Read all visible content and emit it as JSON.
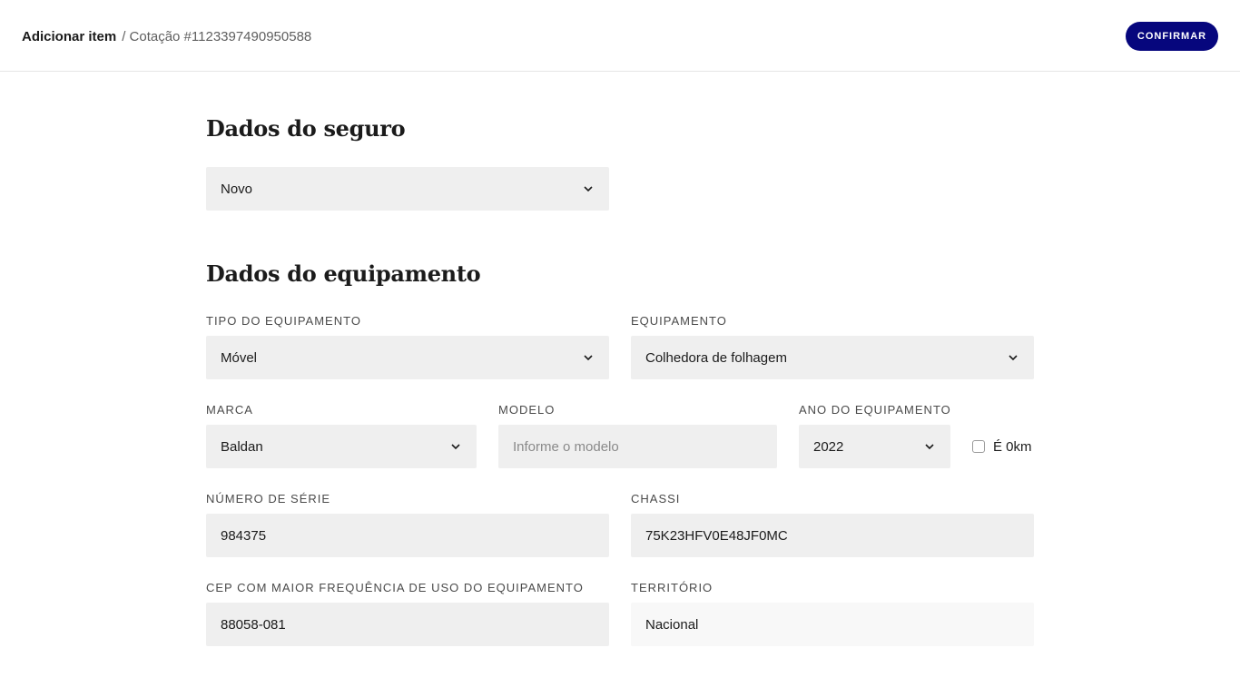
{
  "header": {
    "title": "Adicionar item",
    "subtitle": "/ Cotação #1123397490950588",
    "confirm_label": "CONFIRMAR"
  },
  "insurance": {
    "heading": "Dados do seguro",
    "type_value": "Novo"
  },
  "equipment": {
    "heading": "Dados do equipamento",
    "type": {
      "label": "TIPO DO EQUIPAMENTO",
      "value": "Móvel"
    },
    "equipment": {
      "label": "EQUIPAMENTO",
      "value": "Colhedora de folhagem"
    },
    "brand": {
      "label": "MARCA",
      "value": "Baldan"
    },
    "model": {
      "label": "MODELO",
      "value": "",
      "placeholder": "Informe o modelo"
    },
    "year": {
      "label": "ANO DO EQUIPAMENTO",
      "value": "2022"
    },
    "zero_km": {
      "label": "É 0km",
      "checked": false
    },
    "serial": {
      "label": "NÚMERO DE SÉRIE",
      "value": "984375"
    },
    "chassis": {
      "label": "CHASSI",
      "value": "75K23HFV0E48JF0MC"
    },
    "cep": {
      "label": "CEP COM MAIOR FREQUÊNCIA DE USO DO EQUIPAMENTO",
      "value": "88058-081"
    },
    "territory": {
      "label": "TERRITÓRIO",
      "value": "Nacional"
    }
  },
  "colors": {
    "accent": "#06067d",
    "field_bg": "#efefef",
    "readonly_bg": "#f8f8f8"
  },
  "icons": {
    "dropdown": "chevron-down-icon"
  }
}
